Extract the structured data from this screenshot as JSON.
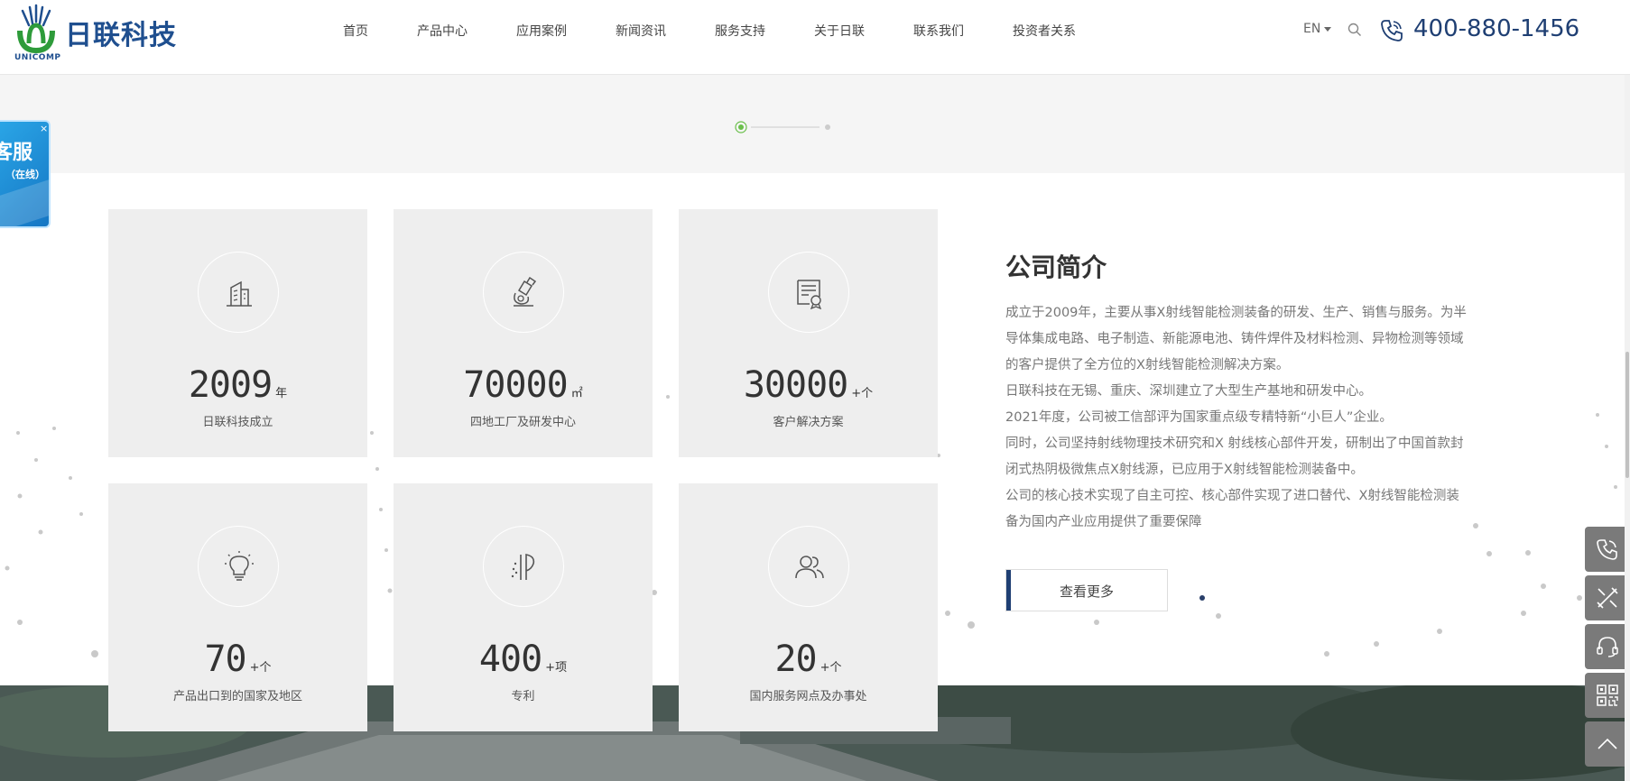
{
  "brand": {
    "name_cn": "日联科技",
    "name_en": "UNICOMP",
    "color": "#1f4f8f",
    "accent": "#2e9b3a"
  },
  "nav": {
    "items": [
      {
        "label": "首页"
      },
      {
        "label": "产品中心"
      },
      {
        "label": "应用案例"
      },
      {
        "label": "新闻资讯"
      },
      {
        "label": "服务支持"
      },
      {
        "label": "关于日联"
      },
      {
        "label": "联系我们"
      },
      {
        "label": "投资者关系"
      }
    ]
  },
  "header": {
    "lang_label": "EN",
    "search_icon": "search-icon",
    "phone_icon": "phone-icon",
    "phone_number": "400-880-1456"
  },
  "pager": {
    "active_index": 0,
    "total": 2,
    "active_color": "#6abf4b"
  },
  "stats": [
    {
      "icon": "building-icon",
      "value": "2009",
      "unit": "年",
      "label": "日联科技成立"
    },
    {
      "icon": "microscope-icon",
      "value": "70000",
      "unit": "㎡",
      "label": "四地工厂及研发中心"
    },
    {
      "icon": "certificate-icon",
      "value": "30000",
      "unit": "+个",
      "label": "客户解决方案"
    },
    {
      "icon": "lightbulb-icon",
      "value": "70",
      "unit": "+个",
      "label": "产品出口到的国家及地区"
    },
    {
      "icon": "patent-icon",
      "value": "400",
      "unit": "+项",
      "label": "专利"
    },
    {
      "icon": "users-icon",
      "value": "20",
      "unit": "+个",
      "label": "国内服务网点及办事处"
    }
  ],
  "about": {
    "title": "公司简介",
    "paragraphs": [
      "成立于2009年，主要从事X射线智能检测装备的研发、生产、销售与服务。为半导体集成电路、电子制造、新能源电池、铸件焊件及材料检测、异物检测等领域的客户提供了全方位的X射线智能检测解决方案。",
      "日联科技在无锡、重庆、深圳建立了大型生产基地和研发中心。",
      "2021年度，公司被工信部评为国家重点级专精特新“小巨人”企业。",
      "同时，公司坚持射线物理技术研究和X 射线核心部件开发，研制出了中国首款封闭式热阴极微焦点X射线源，已应用于X射线智能检测装备中。",
      "公司的核心技术实现了自主可控、核心部件实现了进口替代、X射线智能检测装备为国内产业应用提供了重要保障"
    ],
    "more_label": "查看更多"
  },
  "kefu": {
    "title": "客服",
    "status": "（在线）",
    "close": "×"
  },
  "sidebar": {
    "items": [
      {
        "icon": "phone-icon"
      },
      {
        "icon": "tools-icon"
      },
      {
        "icon": "headset-icon"
      },
      {
        "icon": "qrcode-icon"
      },
      {
        "icon": "back-to-top-icon"
      }
    ]
  }
}
